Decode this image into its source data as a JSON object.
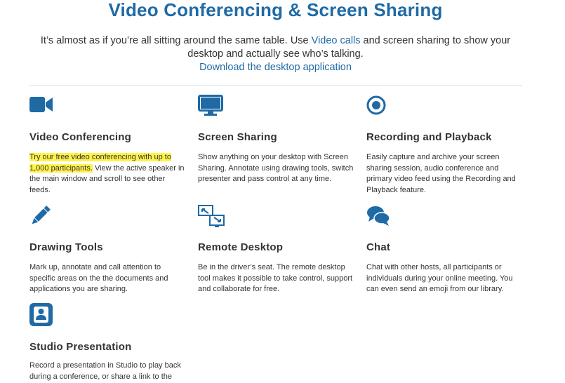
{
  "header": {
    "title": "Video Conferencing & Screen Sharing",
    "intro_line1_before": "It’s almost as if you’re all sitting around the same table. Use ",
    "intro_link_video_calls": "Video calls",
    "intro_line1_after": " and screen sharing to show your",
    "intro_line2": "desktop and actually see who’s talking.",
    "download_link": "Download the desktop application"
  },
  "features": [
    {
      "icon": "video-camera-icon",
      "title": "Video Conferencing",
      "desc_highlight": "Try our free video conferencing with up to 1,000 participants.",
      "desc": " View the active speaker in the main window and scroll to see other feeds."
    },
    {
      "icon": "monitor-icon",
      "title": "Screen Sharing",
      "desc": "Show anything on your desktop with Screen Sharing. Annotate using drawing tools, switch presenter and pass control at any time."
    },
    {
      "icon": "record-icon",
      "title": "Recording and Playback",
      "desc": "Easily capture and archive your screen sharing session, audio conference and primary video feed using the Recording and Playback feature."
    },
    {
      "icon": "pencil-icon",
      "title": "Drawing Tools",
      "desc": "Mark up, annotate and call attention to specific areas on the the documents and applications you are sharing."
    },
    {
      "icon": "remote-desktop-icon",
      "title": "Remote Desktop",
      "desc": "Be in the driver’s seat. The remote desktop tool makes it possible to take control, support and collaborate for free."
    },
    {
      "icon": "chat-bubbles-icon",
      "title": "Chat",
      "desc": "Chat with other hosts, all participants or individuals during your online meeting. You can even send an emoji from our library."
    },
    {
      "icon": "presenter-icon",
      "title": "Studio Presentation",
      "desc": "Record a presentation in Studio to play back during a conference, or share a link to the"
    }
  ],
  "colors": {
    "brand_blue": "#1f6aa5",
    "text": "#333333",
    "highlight": "#fff34a"
  }
}
